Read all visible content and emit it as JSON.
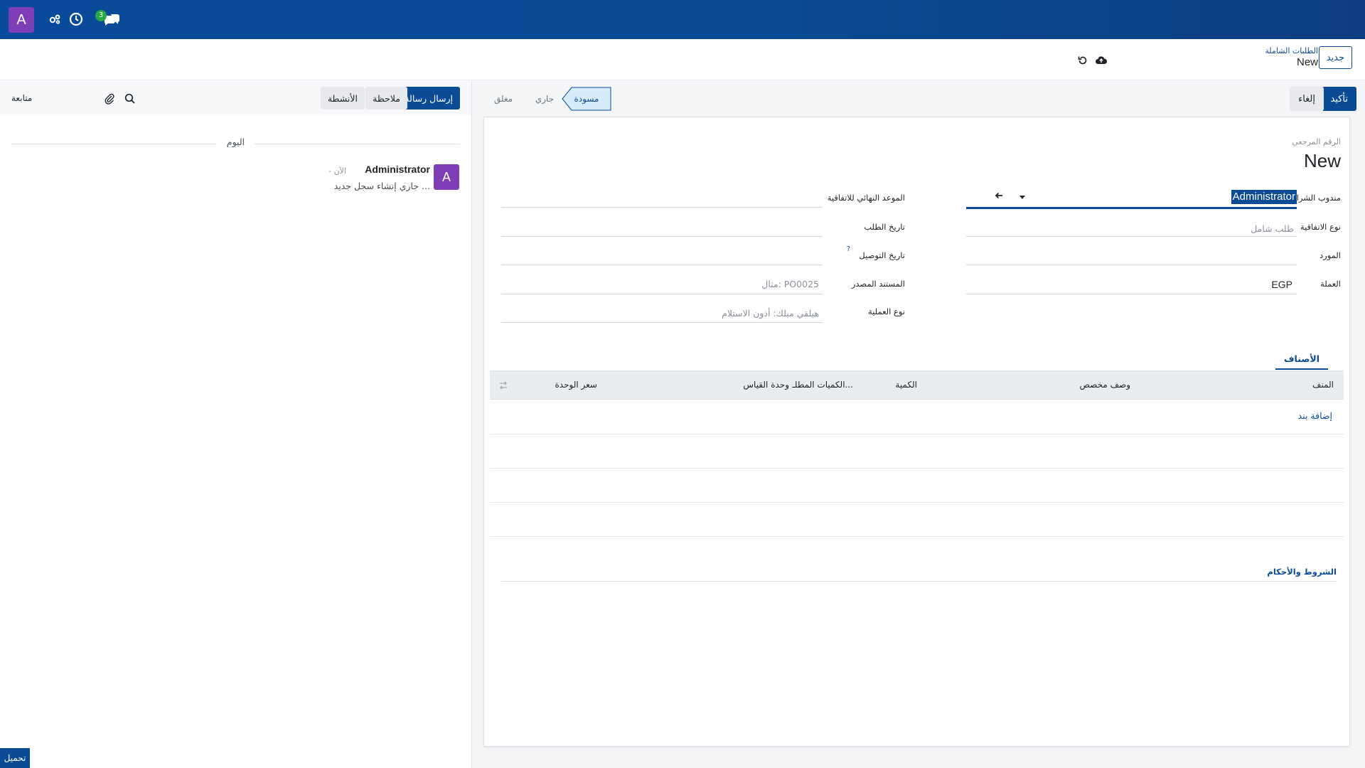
{
  "navbar": {
    "user_initial": "A",
    "messages_badge": "3"
  },
  "control_panel": {
    "new_button": "جديد",
    "breadcrumb_parent": "الطلبات الشاملة",
    "breadcrumb_current": "New"
  },
  "statusbar": {
    "confirm_button": "تأكيد",
    "cancel_button": "إلغاء",
    "stages": [
      "مسودة",
      "جاري",
      "مغلق"
    ],
    "active_stage": "مسودة"
  },
  "form": {
    "reference_label": "الرقم المرجعي",
    "reference_value": "New",
    "left_fields": {
      "purchase_rep_label": "مندوب الشراء",
      "purchase_rep_value": "Administrator",
      "agreement_type_label": "نوع الاتفاقية",
      "agreement_type_value": "طلب شامل",
      "vendor_label": "المورد",
      "currency_label": "العملة",
      "currency_value": "EGP"
    },
    "right_fields": {
      "deadline_label": "الموعد النهائي للاتفاقية",
      "order_date_label": "تاريخ الطلب",
      "delivery_date_label": "تاريخ التوصيل",
      "delivery_date_help": "?",
      "source_doc_label": "المستند المصدر",
      "source_doc_placeholder": "مثال: PO0025",
      "operation_type_label": "نوع العملية",
      "operation_type_placeholder": "هيلقي ميلك: أذون الاستلام"
    },
    "tab_products": "الأصناف",
    "table": {
      "columns": [
        "المنف",
        "وصف مخصص",
        "الكمية",
        "الكميات المطلـ...",
        "وحدة القياس",
        "سعر الوحدة"
      ],
      "add_line": "إضافة بند"
    },
    "terms_label": "الشروط والأحكام"
  },
  "chatter": {
    "send_message": "إرسال رسالة",
    "log_note": "ملاحظة",
    "activities": "الأنشطة",
    "follow": "متابعة",
    "date_separator": "اليوم",
    "message": {
      "author": "Administrator",
      "time": "- الآن",
      "body": "جاري إنشاء سجل جديد ...",
      "avatar_initial": "A"
    }
  },
  "upload_button": "تحميل",
  "colors": {
    "primary": "#0b4b95",
    "avatar": "#7e3fb6",
    "badge": "#28a745"
  }
}
